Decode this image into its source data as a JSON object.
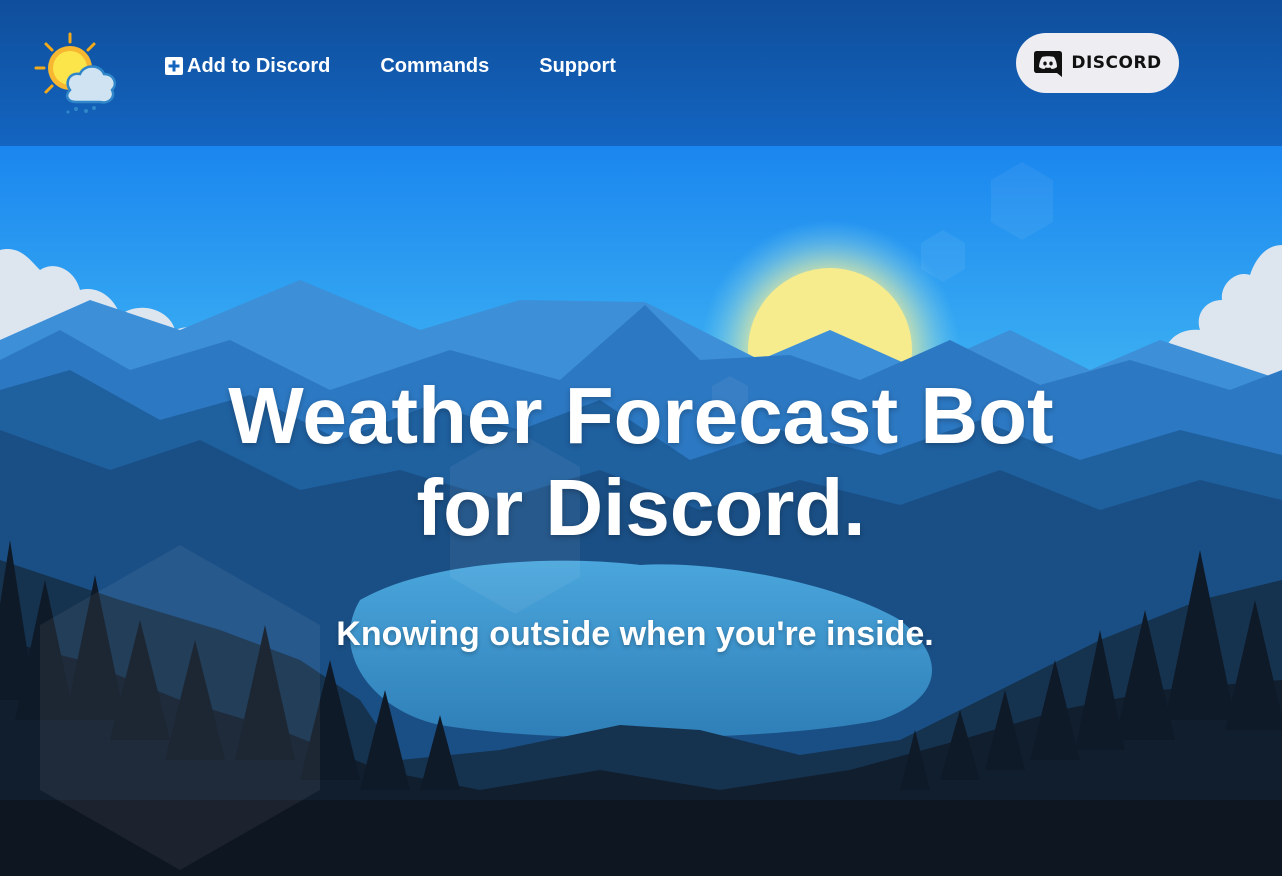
{
  "nav": {
    "add_to_discord": "Add to Discord",
    "commands": "Commands",
    "support": "Support"
  },
  "discord_button": {
    "label": "DISCORD",
    "icon": "discord-logo-icon"
  },
  "logo": {
    "icon": "sun-cloud-rain-logo"
  },
  "hero": {
    "title_line1": "Weather Forecast Bot",
    "title_line2": "for Discord.",
    "tagline": "Knowing outside when you're inside."
  },
  "colors": {
    "nav_bg": "#0f4e9b",
    "sky_top": "#1e8ff0",
    "sun": "#f6ec8e",
    "button_bg": "#eeeef2",
    "text": "#ffffff"
  }
}
